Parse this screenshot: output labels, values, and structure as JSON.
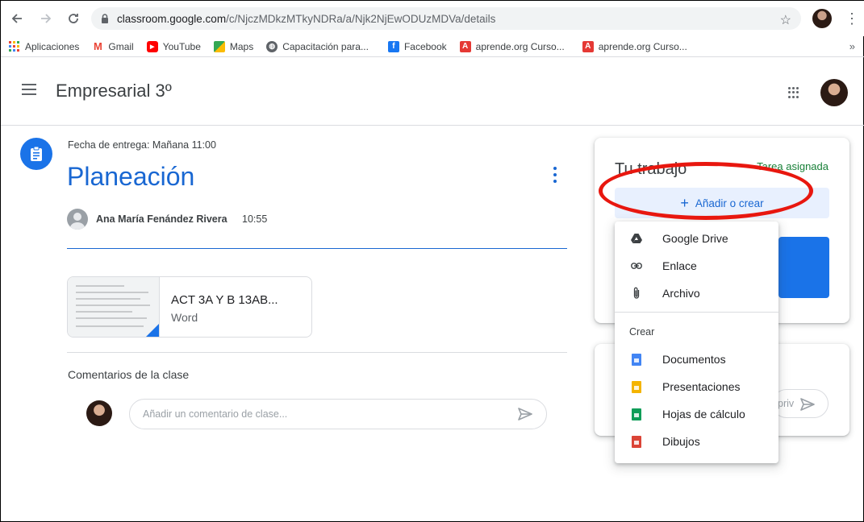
{
  "browser": {
    "url_main": "classroom.google.com",
    "url_path": "/c/NjczMDkzMTkyNDRa/a/Njk2NjEwODUzMDVa/details",
    "bookmarks": [
      {
        "label": "Aplicaciones",
        "icon": "apps-grid-icon",
        "color": "#e8453c"
      },
      {
        "label": "Gmail",
        "icon": "gmail-icon",
        "color": "#ea4335"
      },
      {
        "label": "YouTube",
        "icon": "youtube-icon",
        "color": "#ff0000"
      },
      {
        "label": "Maps",
        "icon": "maps-icon",
        "color": "#34a853"
      },
      {
        "label": "Capacitación para...",
        "icon": "globe-icon",
        "color": "#5f6368"
      },
      {
        "label": "Facebook",
        "icon": "facebook-icon",
        "color": "#1877f2"
      },
      {
        "label": "aprende.org Curso...",
        "icon": "aprende-icon",
        "color": "#e53935"
      },
      {
        "label": "aprende.org Curso...",
        "icon": "aprende-icon",
        "color": "#e53935"
      }
    ]
  },
  "header": {
    "class_name": "Empresarial 3º"
  },
  "assignment": {
    "due": "Fecha de entrega: Mañana 11:00",
    "title": "Planeación",
    "author": "Ana María Fenández Rivera",
    "time": "10:55",
    "attachment": {
      "name": "ACT 3A Y B 13AB...",
      "type": "Word"
    }
  },
  "comments": {
    "title": "Comentarios de la clase",
    "placeholder": "Añadir un comentario de clase..."
  },
  "your_work": {
    "title": "Tu trabajo",
    "status": "Tarea asignada",
    "add_button": "Añadir o crear",
    "private_placeholder": "priv"
  },
  "menu": {
    "items": [
      {
        "label": "Google Drive",
        "icon": "google-drive-icon"
      },
      {
        "label": "Enlace",
        "icon": "link-icon"
      },
      {
        "label": "Archivo",
        "icon": "paperclip-icon"
      }
    ],
    "create_label": "Crear",
    "create_items": [
      {
        "label": "Documentos",
        "icon": "docs-icon",
        "color": "#4285f4"
      },
      {
        "label": "Presentaciones",
        "icon": "slides-icon",
        "color": "#f4b400"
      },
      {
        "label": "Hojas de cálculo",
        "icon": "sheets-icon",
        "color": "#0f9d58"
      },
      {
        "label": "Dibujos",
        "icon": "drawings-icon",
        "color": "#db4437"
      }
    ]
  },
  "colors": {
    "accent": "#1967d2",
    "annotation": "#e8170f",
    "status_green": "#188038"
  }
}
